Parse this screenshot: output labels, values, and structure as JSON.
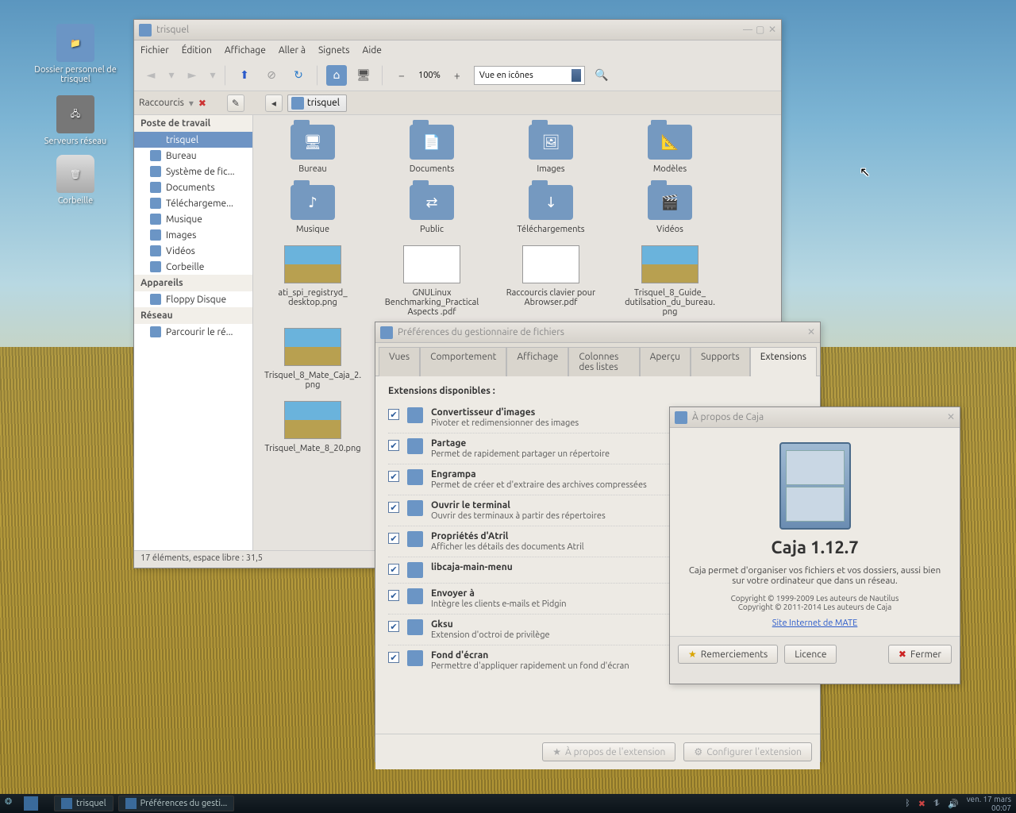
{
  "desktop": {
    "icons": [
      {
        "label": "Dossier personnel de trisquel"
      },
      {
        "label": "Serveurs réseau"
      },
      {
        "label": "Corbeille"
      }
    ]
  },
  "fm": {
    "title": "trisquel",
    "menus": [
      "Fichier",
      "Édition",
      "Affichage",
      "Aller à",
      "Signets",
      "Aide"
    ],
    "zoom": "100%",
    "view": "Vue en icônes",
    "sidecaption": "Raccourcis",
    "locchip": "trisquel",
    "sections": [
      {
        "head": "Poste de travail",
        "items": [
          {
            "label": "trisquel",
            "sel": true
          },
          {
            "label": "Bureau"
          },
          {
            "label": "Système de fic..."
          },
          {
            "label": "Documents"
          },
          {
            "label": "Téléchargeme..."
          },
          {
            "label": "Musique"
          },
          {
            "label": "Images"
          },
          {
            "label": "Vidéos"
          },
          {
            "label": "Corbeille"
          }
        ]
      },
      {
        "head": "Appareils",
        "items": [
          {
            "label": "Floppy Disque"
          }
        ]
      },
      {
        "head": "Réseau",
        "items": [
          {
            "label": "Parcourir le ré..."
          }
        ]
      }
    ],
    "folders": [
      {
        "label": "Bureau",
        "g": "🖥"
      },
      {
        "label": "Documents",
        "g": "📄"
      },
      {
        "label": "Images",
        "g": "🖼"
      },
      {
        "label": "Modèles",
        "g": "📐"
      },
      {
        "label": "Musique",
        "g": "♪"
      },
      {
        "label": "Public",
        "g": "⇄"
      },
      {
        "label": "Téléchargements",
        "g": "↓"
      },
      {
        "label": "Vidéos",
        "g": "🎬"
      }
    ],
    "files": [
      {
        "label": "ati_spi_registryd_\ndesktop.png",
        "k": "img"
      },
      {
        "label": "GNULinux\nBenchmarking_Practical\nAspects .pdf",
        "k": "doc"
      },
      {
        "label": "Raccourcis clavier pour\nAbrowser.pdf",
        "k": "doc"
      },
      {
        "label": "Trisquel_8_Guide_\ndutilsation_du_bureau.\npng",
        "k": "img"
      },
      {
        "label": "Trisquel_8_Mate_Caja_2.\npng",
        "k": "img"
      },
      {
        "label": " ",
        "k": "spacer"
      },
      {
        "label": " ",
        "k": "spacer"
      },
      {
        "label": " ",
        "k": "spacer"
      },
      {
        "label": "Trisquel_Mate_8_20.png",
        "k": "img"
      }
    ],
    "status": "17 éléments, espace libre : 31,5"
  },
  "prefs": {
    "title": "Préférences du gestionnaire de fichiers",
    "tabs": [
      "Vues",
      "Comportement",
      "Affichage",
      "Colonnes des listes",
      "Aperçu",
      "Supports",
      "Extensions"
    ],
    "active": 6,
    "avail": "Extensions disponibles :",
    "ext": [
      {
        "n": "Convertisseur d'images",
        "d": "Pivoter et redimensionner des images"
      },
      {
        "n": "Partage",
        "d": "Permet de rapidement partager un répertoire"
      },
      {
        "n": "Engrampa",
        "d": "Permet de créer et d'extraire des archives compressées"
      },
      {
        "n": "Ouvrir le terminal",
        "d": "Ouvrir des terminaux à partir des répertoires"
      },
      {
        "n": "Propriétés d'Atril",
        "d": "Afficher les détails des documents Atril"
      },
      {
        "n": "libcaja-main-menu",
        "d": ""
      },
      {
        "n": "Envoyer à",
        "d": "Intègre les clients e-mails et Pidgin"
      },
      {
        "n": "Gksu",
        "d": "Extension d'octroi de privilège"
      },
      {
        "n": "Fond d'écran",
        "d": "Permettre d'appliquer rapidement un fond d'écran"
      }
    ],
    "btns": {
      "about": "À propos de l'extension",
      "conf": "Configurer l'extension"
    }
  },
  "about": {
    "title": "À propos de Caja",
    "name": "Caja 1.12.7",
    "desc": "Caja permet d'organiser vos fichiers et vos dossiers, aussi bien sur votre ordinateur que dans un réseau.",
    "c1": "Copyright © 1999-2009 Les auteurs de Nautilus",
    "c2": "Copyright © 2011-2014 Les auteurs de Caja",
    "link": "Site Internet de MATE",
    "btns": {
      "thanks": "Remerciements",
      "lic": "Licence",
      "close": "Fermer"
    }
  },
  "panel": {
    "tasks": [
      {
        "label": "trisquel"
      },
      {
        "label": "Préférences du gesti..."
      }
    ],
    "date": "ven. 17 mars",
    "time": "00:07"
  }
}
